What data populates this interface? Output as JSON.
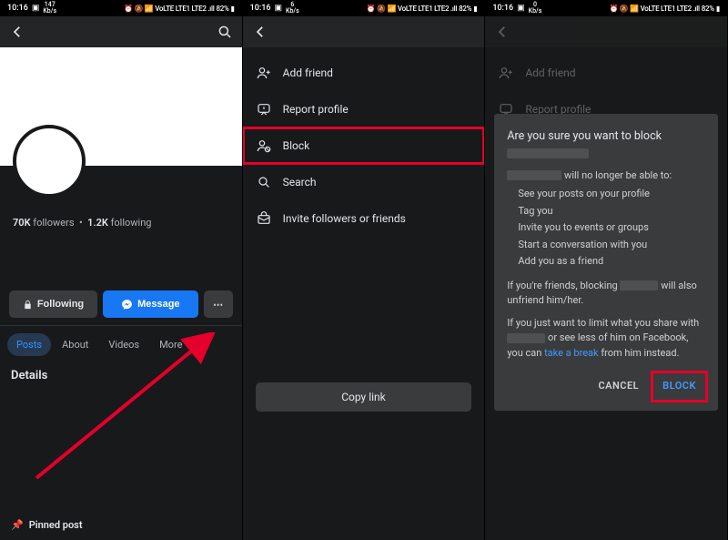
{
  "status": {
    "time": "10:16",
    "speed_top": "147",
    "speed_bottom": "Kb/s",
    "speed2_top": "0",
    "speed2_bottom": "Kb/s",
    "alt_count": "6",
    "indicators": "⏰ 🔕 📶 VoLTE LTE1 LTE2 .ıll",
    "battery": "82%"
  },
  "profile": {
    "followers_count": "70K",
    "followers_label": "followers",
    "following_count": "1.2K",
    "following_label": "following",
    "following_btn": "Following",
    "message_btn": "Message",
    "more_btn": "⋯",
    "tabs": {
      "posts": "Posts",
      "about": "About",
      "videos": "Videos",
      "more": "More"
    },
    "details_heading": "Details",
    "pinned": "Pinned post"
  },
  "menu": {
    "add_friend": "Add friend",
    "report_profile": "Report profile",
    "block": "Block",
    "search": "Search",
    "invite": "Invite followers or friends",
    "copy_link": "Copy link"
  },
  "modal": {
    "title": "Are you sure you want to block",
    "will_no_longer": "will no longer be able to:",
    "bullets": [
      "See your posts on your profile",
      "Tag you",
      "Invite you to events or groups",
      "Start a conversation with you",
      "Add you as a friend"
    ],
    "friends_note_a": "If you're friends, blocking",
    "friends_note_b": "will also unfriend him/her.",
    "limit_a": "If you just want to limit what you share with",
    "limit_b": "or see less of him on Facebook, you can",
    "take_break": "take a break",
    "limit_c": "from him instead.",
    "cancel": "CANCEL",
    "block": "BLOCK"
  }
}
